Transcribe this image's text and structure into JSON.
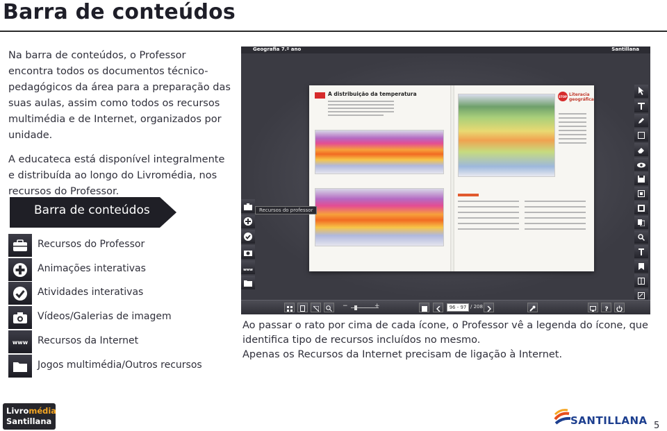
{
  "page": {
    "title": "Barra de conteúdos",
    "intro_paragraphs": [
      "Na barra de conteúdos, o Professor encontra todos os documentos técnico-pedagógicos da área para a preparação das suas aulas, assim como todos os recursos multimédia e de Internet, organizados por unidade.",
      "A educateca está disponível integralmente e distribuída ao longo do Livromédia, nos recursos do Professor."
    ],
    "banner_label": "Barra de conteúdos",
    "legend": [
      {
        "icon": "briefcase-icon",
        "label": "Recursos do Professor"
      },
      {
        "icon": "plus-circle-icon",
        "label": "Animações interativas"
      },
      {
        "icon": "checkmark-circle-icon",
        "label": "Atividades interativas"
      },
      {
        "icon": "camera-icon",
        "label": "Vídeos/Galerias de imagem"
      },
      {
        "icon": "www-icon",
        "label": "Recursos da Internet"
      },
      {
        "icon": "folder-icon",
        "label": "Jogos multimédia/Outros recursos"
      }
    ],
    "caption_lines": [
      "Ao passar o rato por cima de cada ícone, o Professor vê a legenda do ícone, que identifica tipo de recursos incluídos no mesmo.",
      "Apenas os Recursos da Internet precisam de ligação à Internet."
    ],
    "page_number": "5"
  },
  "screenshot": {
    "book_label": "Geografia 7.º ano",
    "publisher": "Santillana",
    "chapter_number": "4.4",
    "chapter_title": "A distribuição da temperatura",
    "side_title": "Literacia geográfica",
    "stop_label": "STOP",
    "tooltip": "Recursos do professor",
    "page_field": "96 - 97",
    "page_total": "/ 208"
  },
  "logos": {
    "left_line1_a": "Livro",
    "left_line1_b": "média",
    "left_line2": "Santillana",
    "right": "SANTILLANA"
  },
  "colors": {
    "accent_orange": "#f5a623",
    "chapter_red": "#d62b2b",
    "brand_blue": "#1d3f8f"
  }
}
